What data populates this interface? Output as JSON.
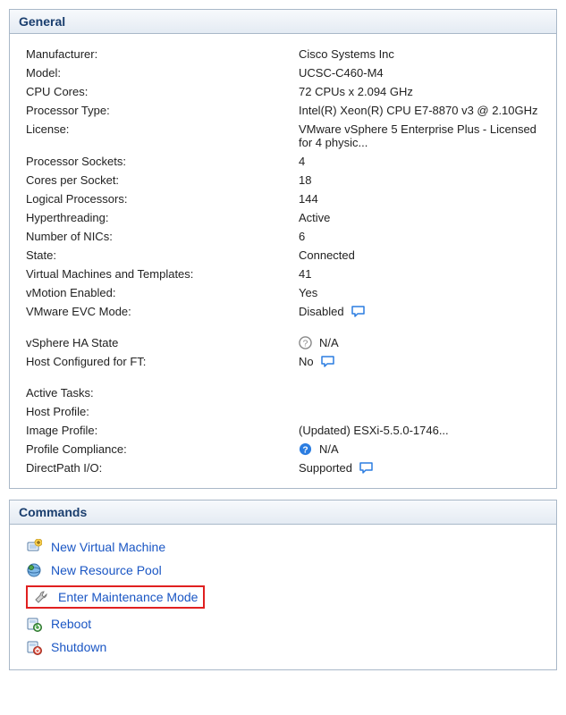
{
  "panels": {
    "general": {
      "title": "General",
      "rows": [
        {
          "label": "Manufacturer:",
          "value": "Cisco Systems Inc"
        },
        {
          "label": "Model:",
          "value": "UCSC-C460-M4"
        },
        {
          "label": "CPU Cores:",
          "value": "72 CPUs x 2.094 GHz"
        },
        {
          "label": "Processor Type:",
          "value": "Intel(R) Xeon(R) CPU E7-8870 v3 @ 2.10GHz"
        },
        {
          "label": "License:",
          "value": "VMware vSphere 5 Enterprise Plus - Licensed for 4 physic..."
        },
        {
          "label": "Processor Sockets:",
          "value": "4"
        },
        {
          "label": "Cores per Socket:",
          "value": "18"
        },
        {
          "label": "Logical Processors:",
          "value": "144"
        },
        {
          "label": "Hyperthreading:",
          "value": "Active"
        },
        {
          "label": "Number of NICs:",
          "value": "6"
        },
        {
          "label": "State:",
          "value": "Connected"
        },
        {
          "label": "Virtual Machines and Templates:",
          "value": "41"
        },
        {
          "label": "vMotion Enabled:",
          "value": "Yes"
        },
        {
          "label": "VMware EVC Mode:",
          "value": "Disabled",
          "bubble": true
        },
        {
          "label": "vSphere HA State",
          "value": "N/A",
          "help_gray": true,
          "gap_top": true
        },
        {
          "label": "Host Configured for FT:",
          "value": "No",
          "bubble": true
        },
        {
          "label": "Active Tasks:",
          "value": "",
          "gap_top": true
        },
        {
          "label": "Host Profile:",
          "value": ""
        },
        {
          "label": "Image Profile:",
          "value": "(Updated) ESXi-5.5.0-1746..."
        },
        {
          "label": "Profile Compliance:",
          "value": "N/A",
          "help_blue": true
        },
        {
          "label": "DirectPath I/O:",
          "value": "Supported",
          "bubble": true
        }
      ]
    },
    "commands": {
      "title": "Commands",
      "items": [
        {
          "label": "New Virtual Machine",
          "icon": "new-vm-icon"
        },
        {
          "label": "New Resource Pool",
          "icon": "new-pool-icon"
        },
        {
          "label": "Enter Maintenance Mode",
          "icon": "maintenance-icon",
          "highlighted": true
        },
        {
          "label": "Reboot",
          "icon": "reboot-icon"
        },
        {
          "label": "Shutdown",
          "icon": "shutdown-icon"
        }
      ]
    }
  }
}
